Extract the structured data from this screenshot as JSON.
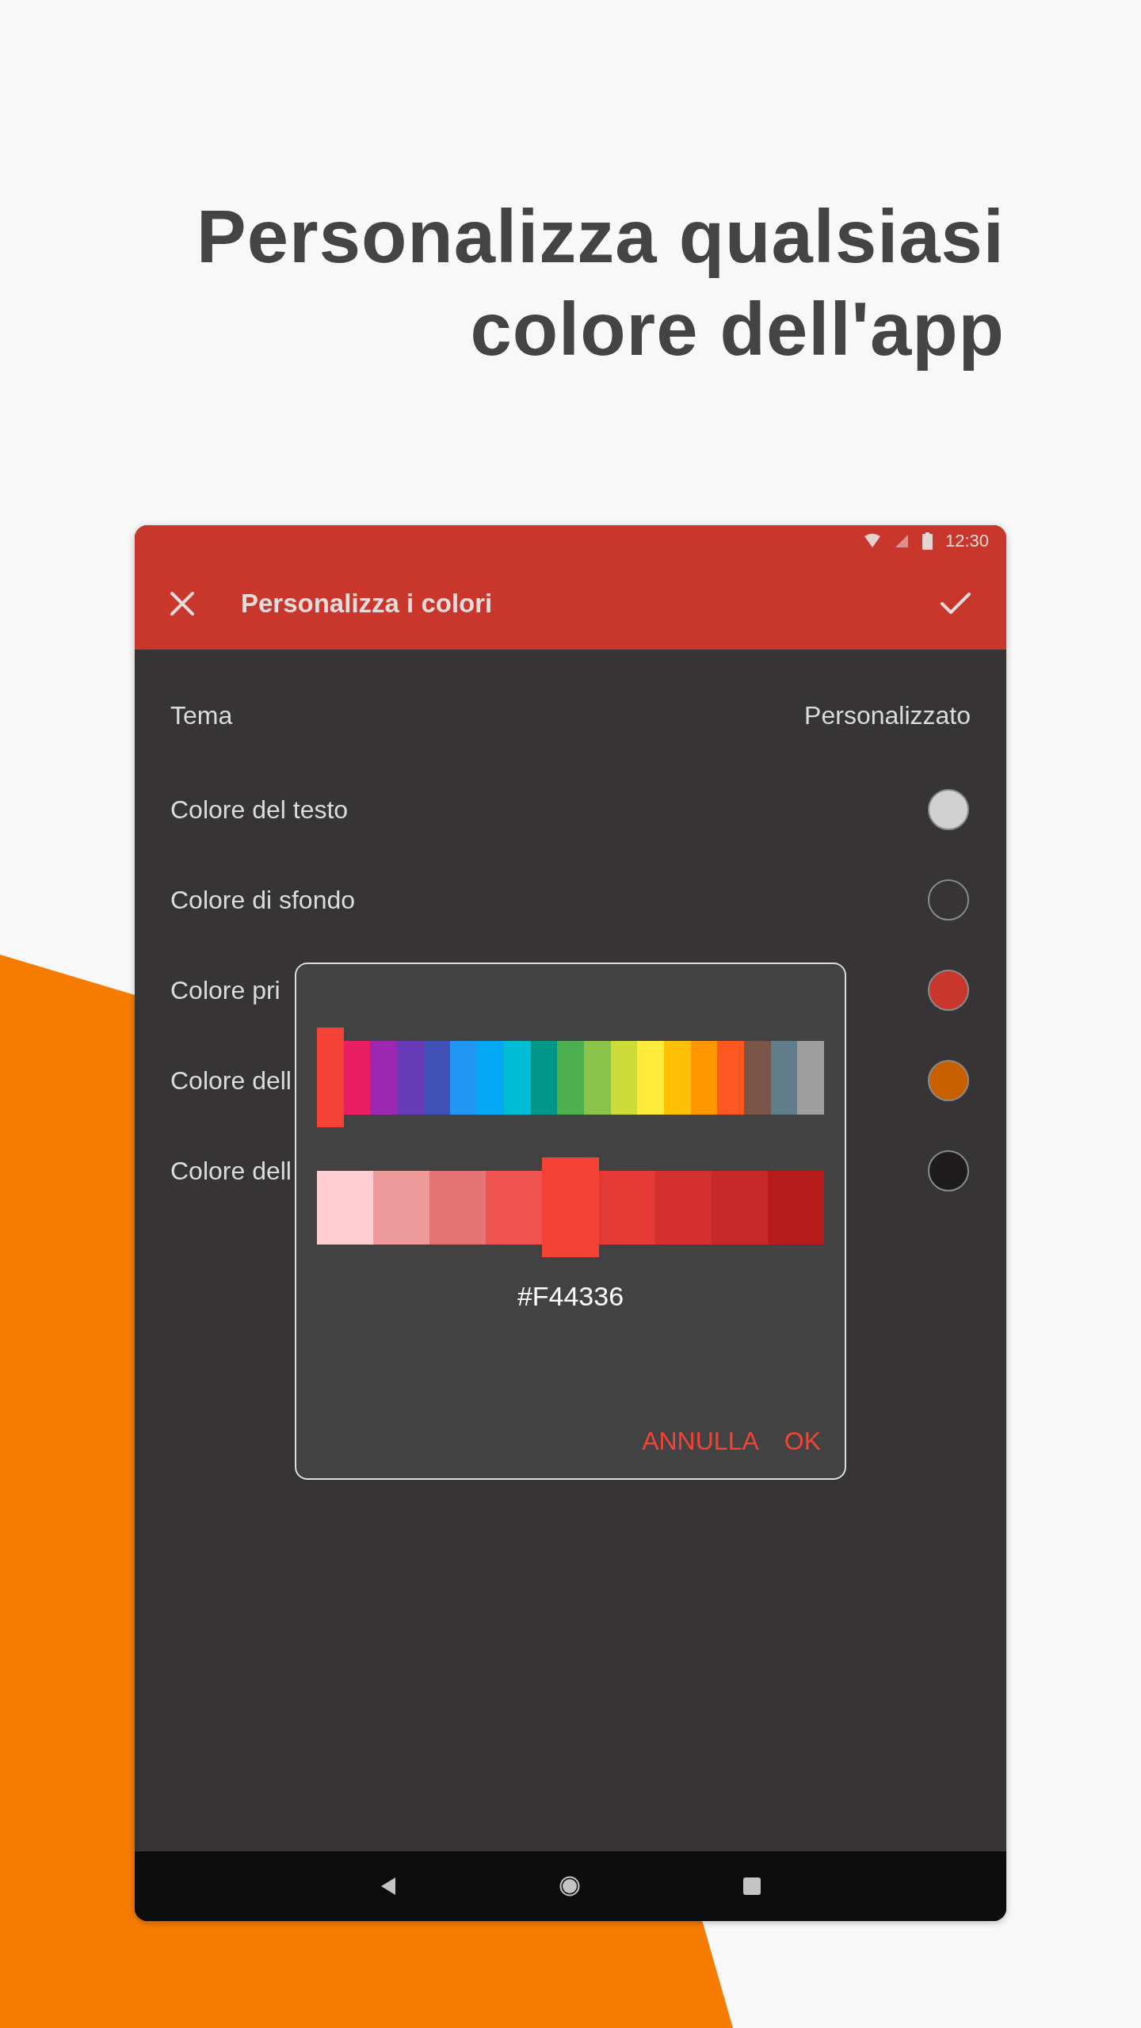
{
  "headline": [
    "Personalizza qualsiasi",
    "colore dell'app"
  ],
  "status_bar": {
    "time": "12:30"
  },
  "toolbar": {
    "title": "Personalizza i colori"
  },
  "settings": [
    {
      "kind": "value",
      "label": "Tema",
      "value": "Personalizzato"
    },
    {
      "kind": "color",
      "label": "Colore del testo",
      "color": "#d2d1d2"
    },
    {
      "kind": "color",
      "label": "Colore di sfondo",
      "color": "#363435"
    },
    {
      "kind": "color",
      "label": "Colore pri",
      "color": "#c9372c"
    },
    {
      "kind": "color",
      "label": "Colore dell",
      "color": "#c96000"
    },
    {
      "kind": "color",
      "label": "Colore dell",
      "color": "#1e1c1c"
    }
  ],
  "dialog": {
    "hues": [
      {
        "color": "#f44336",
        "selected": true
      },
      {
        "color": "#e91e63",
        "selected": false
      },
      {
        "color": "#9c27b0",
        "selected": false
      },
      {
        "color": "#673ab7",
        "selected": false
      },
      {
        "color": "#3f51b5",
        "selected": false
      },
      {
        "color": "#2196f3",
        "selected": false
      },
      {
        "color": "#03a9f4",
        "selected": false
      },
      {
        "color": "#00bcd4",
        "selected": false
      },
      {
        "color": "#009688",
        "selected": false
      },
      {
        "color": "#4caf50",
        "selected": false
      },
      {
        "color": "#8bc34a",
        "selected": false
      },
      {
        "color": "#cddc39",
        "selected": false
      },
      {
        "color": "#ffeb3b",
        "selected": false
      },
      {
        "color": "#ffc107",
        "selected": false
      },
      {
        "color": "#ff9800",
        "selected": false
      },
      {
        "color": "#ff5722",
        "selected": false
      },
      {
        "color": "#795548",
        "selected": false
      },
      {
        "color": "#607d8b",
        "selected": false
      },
      {
        "color": "#9e9e9e",
        "selected": false
      }
    ],
    "shades": [
      {
        "color": "#ffcdd2",
        "selected": false
      },
      {
        "color": "#ef9a9a",
        "selected": false
      },
      {
        "color": "#e57373",
        "selected": false
      },
      {
        "color": "#ef5350",
        "selected": false
      },
      {
        "color": "#f44336",
        "selected": true
      },
      {
        "color": "#e53935",
        "selected": false
      },
      {
        "color": "#d32f2f",
        "selected": false
      },
      {
        "color": "#c62828",
        "selected": false
      },
      {
        "color": "#b71c1c",
        "selected": false
      }
    ],
    "hex": "#F44336",
    "buttons": [
      "ANNULLA",
      "OK"
    ]
  }
}
